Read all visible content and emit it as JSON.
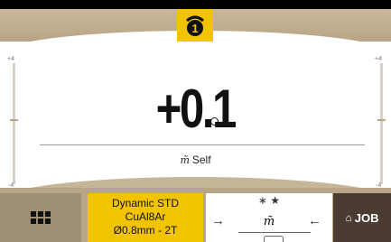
{
  "header": {
    "channel_icon": "welding-torch-icon",
    "channel_number": "1"
  },
  "scale": {
    "left_max": "+4",
    "left_min": "-4",
    "right_max": "+4",
    "right_min": "-4"
  },
  "main": {
    "value": "+0.1",
    "unit_icon": "degree-icon"
  },
  "mode": {
    "icon": "m̃",
    "label": "Self"
  },
  "footer": {
    "menu_icon": "grid-icon",
    "program": {
      "line1": "Dynamic STD",
      "line2": "CuAl8Ar",
      "line3": "Ø0.8mm - 2T"
    },
    "mid": {
      "icons": "∗  ★",
      "left_arrow": "→",
      "right_arrow": "←",
      "center_icon": "m̃"
    },
    "job_label": "JOB",
    "job_icon": "home-icon"
  },
  "colors": {
    "accent_yellow": "#f2c400",
    "bar_tan": "#b7a585",
    "job_dark": "#4a3c33"
  }
}
